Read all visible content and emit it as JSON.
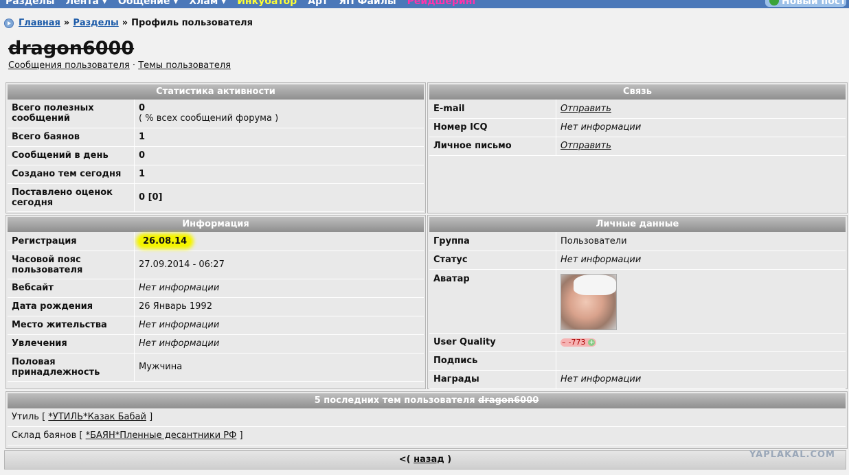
{
  "topnav": {
    "items": [
      "Разделы",
      "Лента ▾",
      "Общение ▾",
      "Хлам ▾",
      "Инкубатор",
      "Арт",
      "ЯП Файлы",
      "Рейдшеринг"
    ],
    "new_post": "Новый пост"
  },
  "breadcrumb": {
    "home": "Главная",
    "sections": "Разделы",
    "sep1": "»",
    "sep2": "»",
    "current": "Профиль пользователя"
  },
  "profile": {
    "username": "dragon6000",
    "link_posts": "Сообщения пользователя",
    "link_sep": "·",
    "link_topics": "Темы пользователя"
  },
  "stats": {
    "title": "Статистика активности",
    "rows": [
      {
        "k": "Всего полезных сообщений",
        "v": "0",
        "v2": "( % всех сообщений форума )"
      },
      {
        "k": "Всего баянов",
        "v": "1"
      },
      {
        "k": "Сообщений в день",
        "v": "0"
      },
      {
        "k": "Создано тем сегодня",
        "v": "1"
      },
      {
        "k": "Поставлено оценок сегодня",
        "v": "0 [0]"
      }
    ]
  },
  "contact": {
    "title": "Связь",
    "rows": [
      {
        "k": "E-mail",
        "v": "Отправить"
      },
      {
        "k": "Номер ICQ",
        "v": "Нет информации"
      },
      {
        "k": "Личное письмо",
        "v": "Отправить"
      }
    ]
  },
  "info": {
    "title": "Информация",
    "rows": [
      {
        "k": "Регистрация",
        "v": "26.08.14"
      },
      {
        "k": "Часовой пояс пользователя",
        "v": "27.09.2014 - 06:27"
      },
      {
        "k": "Вебсайт",
        "v": "Нет информации"
      },
      {
        "k": "Дата рождения",
        "v": "26 Январь 1992"
      },
      {
        "k": "Место жительства",
        "v": "Нет информации"
      },
      {
        "k": "Увлечения",
        "v": "Нет информации"
      },
      {
        "k": "Половая принадлежность",
        "v": "Мужчина"
      }
    ]
  },
  "personal": {
    "title": "Личные данные",
    "rows": [
      {
        "k": "Группа",
        "v": "Пользователи"
      },
      {
        "k": "Статус",
        "v": "Нет информации"
      },
      {
        "k": "Аватар",
        "v": ""
      },
      {
        "k": "User Quality",
        "v": "-773"
      },
      {
        "k": "Подпись",
        "v": ""
      },
      {
        "k": "Награды",
        "v": "Нет информации"
      }
    ],
    "uq_minus": "–",
    "uq_plus": "+"
  },
  "topics": {
    "title_prefix": "5 последних тем пользователя",
    "title_user": "dragon6000",
    "rows": [
      {
        "section": "Утиль",
        "open": "[",
        "link": "*УТИЛЬ*Казак Бабай",
        "close": "]"
      },
      {
        "section": "Склад баянов",
        "open": "[",
        "link": "*БАЯН*Пленные десантники РФ",
        "close": "]"
      }
    ]
  },
  "back": {
    "prefix": "<(",
    "link": "назад",
    "suffix": ")"
  },
  "watermark": "YAPLAKAL.COM",
  "colors": {
    "nav": "#4b78b9",
    "link": "#1b5aa8",
    "highlight": "#f4f400",
    "header": "#8f8f8f"
  }
}
